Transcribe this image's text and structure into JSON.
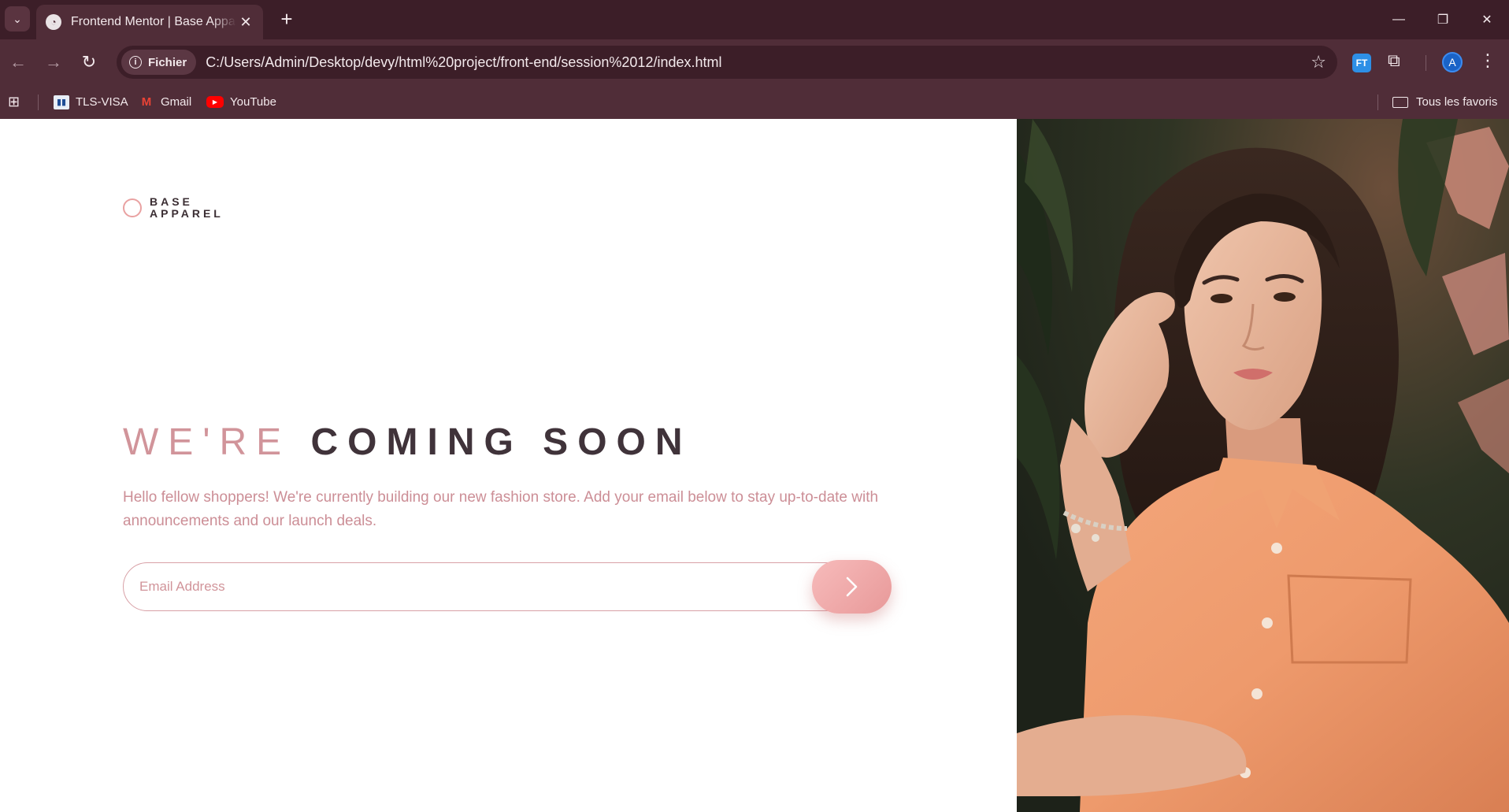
{
  "browser": {
    "tab_title": "Frontend Mentor | Base Apparel",
    "new_tab_icon": "plus-icon",
    "site_chip": "Fichier",
    "url": "C:/Users/Admin/Desktop/devy/html%20project/front-end/session%2012/index.html",
    "extension_label": "FT",
    "avatar_letter": "A",
    "bookmarks": [
      {
        "label": "TLS-VISA",
        "icon": "tls-icon"
      },
      {
        "label": "Gmail",
        "icon": "gmail-icon"
      },
      {
        "label": "YouTube",
        "icon": "youtube-icon"
      }
    ],
    "all_bookmarks": "Tous les favoris"
  },
  "page": {
    "logo": {
      "line1": "BASE",
      "line2": "APPAREL",
      "accent": "#e9a1a1"
    },
    "headline_light": "WE'RE",
    "headline_bold": "COMING SOON",
    "description": "Hello fellow shoppers! We're currently building our new fashion store. Add your email below to stay up-to-date with announcements and our launch deals.",
    "email_placeholder": "Email Address",
    "colors": {
      "accent_light": "#d1949a",
      "text_dark": "#40333a",
      "button_from": "#f7bbbb",
      "button_to": "#e89999",
      "browser_frame": "#502d38"
    }
  }
}
